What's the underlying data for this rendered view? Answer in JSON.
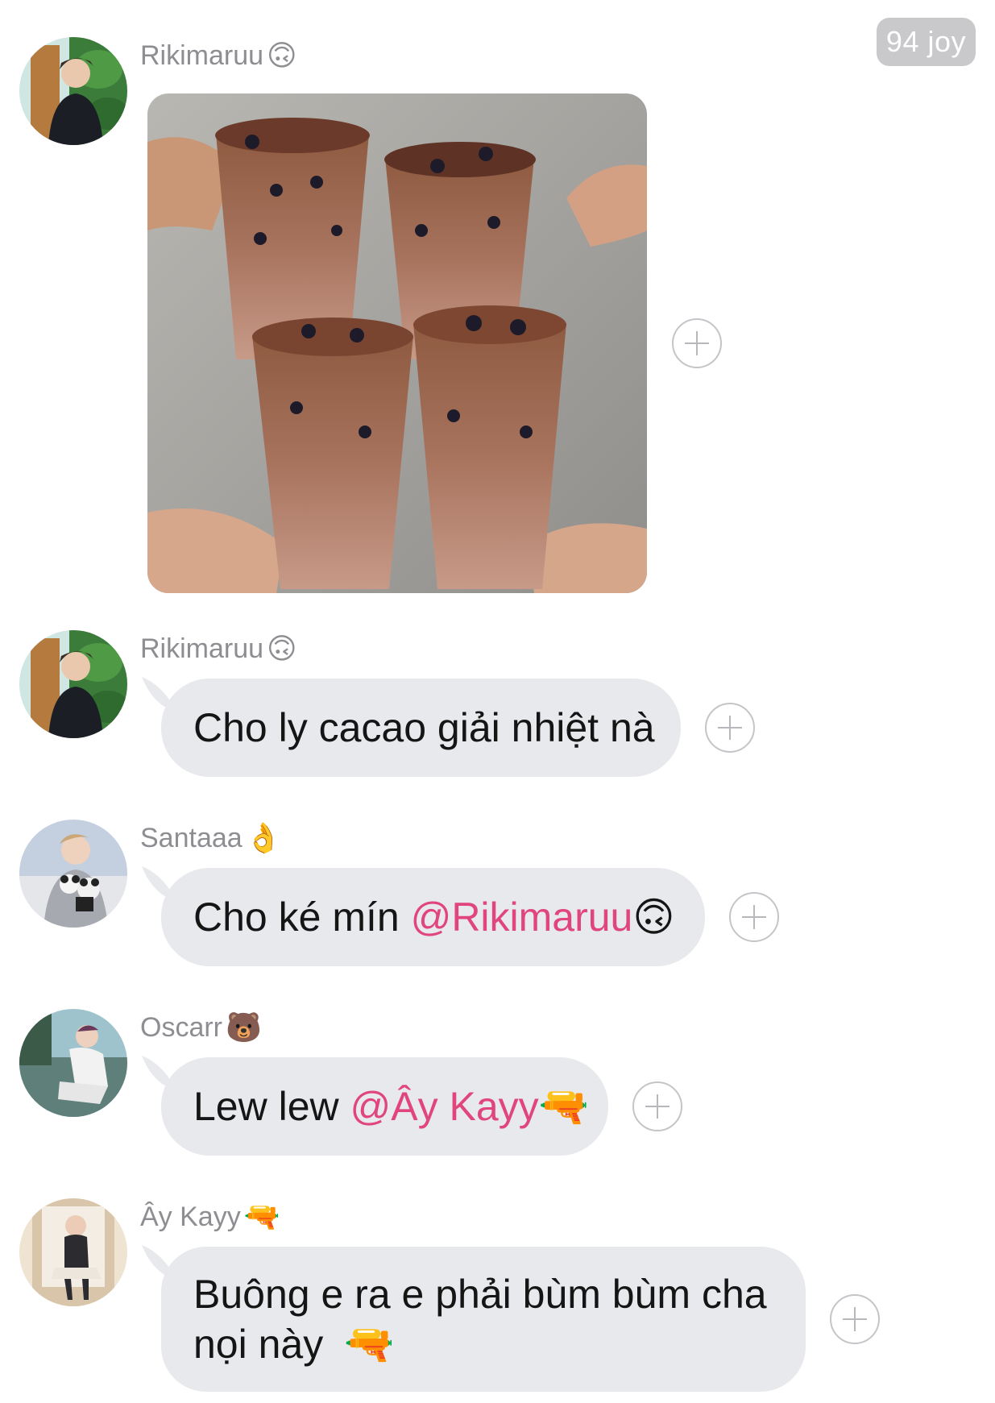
{
  "header": {
    "badge": "94 joy"
  },
  "messages": [
    {
      "sender": "Rikimaruu",
      "sender_emoji": "🙃",
      "type": "image"
    },
    {
      "sender": "Rikimaruu",
      "sender_emoji": "🙃",
      "type": "text",
      "text_before": "Cho ly cacao giải nhiệt nà",
      "mention": "",
      "mention_emoji": ""
    },
    {
      "sender": "Santaaa",
      "sender_emoji": "👌",
      "type": "text",
      "text_before": "Cho ké mín ",
      "mention": "@Rikimaruu",
      "mention_emoji": "🙃"
    },
    {
      "sender": "Oscarr",
      "sender_emoji": "🐻",
      "type": "text",
      "text_before": "Lew lew ",
      "mention": "@Ây Kayy",
      "mention_emoji": "🔫"
    },
    {
      "sender": "Ây Kayy",
      "sender_emoji": "🔫",
      "type": "text",
      "line1": "Buông e ra e phải bùm bùm cha",
      "line2": "nọi này",
      "line2_emoji": "🔫"
    }
  ]
}
